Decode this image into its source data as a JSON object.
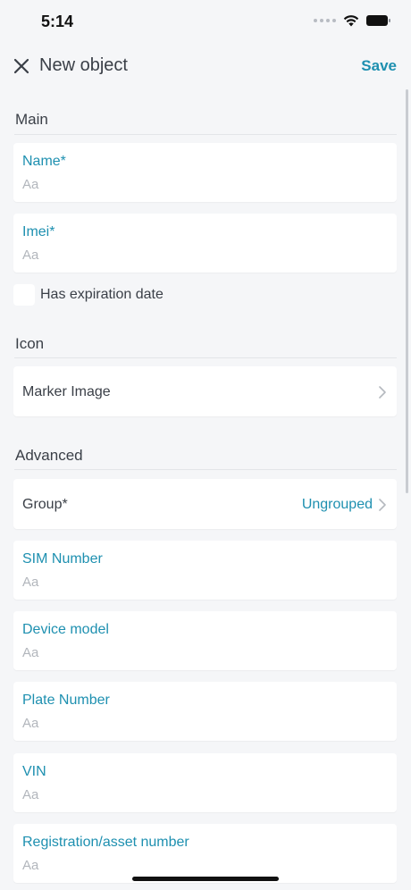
{
  "status": {
    "time": "5:14"
  },
  "nav": {
    "title": "New object",
    "save_label": "Save"
  },
  "sections": {
    "main": "Main",
    "icon": "Icon",
    "advanced": "Advanced"
  },
  "fields": {
    "name": {
      "label": "Name*",
      "placeholder": "Aa"
    },
    "imei": {
      "label": "Imei*",
      "placeholder": "Aa"
    },
    "sim": {
      "label": "SIM Number",
      "placeholder": "Aa"
    },
    "device_model": {
      "label": "Device model",
      "placeholder": "Aa"
    },
    "plate": {
      "label": "Plate Number",
      "placeholder": "Aa"
    },
    "vin": {
      "label": "VIN",
      "placeholder": "Aa"
    },
    "registration": {
      "label": "Registration/asset number",
      "placeholder": "Aa"
    }
  },
  "expiration": {
    "label": "Has expiration date",
    "checked": false
  },
  "marker": {
    "label": "Marker Image"
  },
  "group": {
    "label": "Group*",
    "value": "Ungrouped"
  },
  "colors": {
    "accent": "#1e90b0",
    "background": "#f5f6f8"
  }
}
